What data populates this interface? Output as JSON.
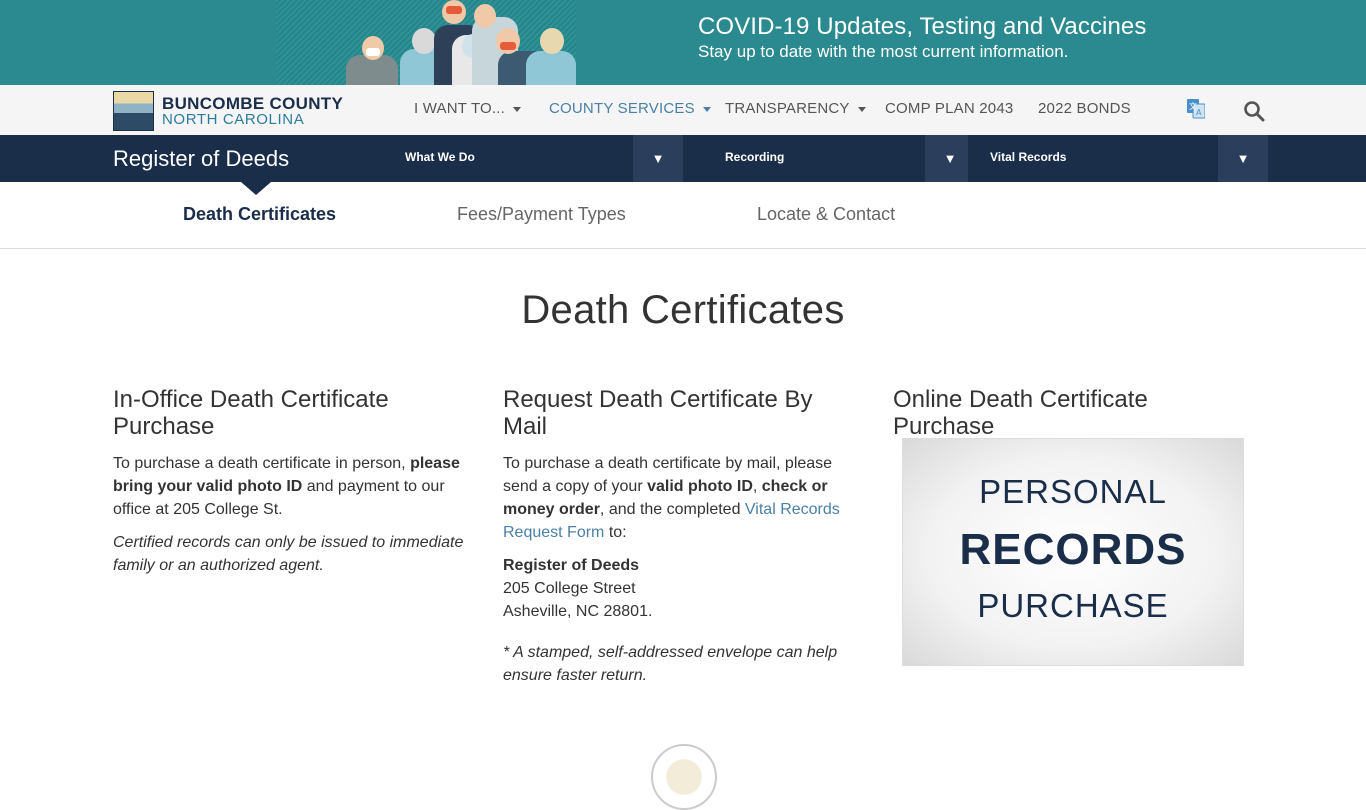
{
  "banner": {
    "title": "COVID-19 Updates, Testing and Vaccines",
    "subtitle": "Stay up to date with the most current information.",
    "bg_color": "#2a8a8f"
  },
  "logo": {
    "line1": "BUNCOMBE COUNTY",
    "line2": "NORTH CAROLINA"
  },
  "nav": {
    "items": [
      {
        "label": "I WANT TO...",
        "dropdown": true
      },
      {
        "label": "COUNTY SERVICES",
        "dropdown": true,
        "active": true
      },
      {
        "label": "TRANSPARENCY",
        "dropdown": true
      },
      {
        "label": "COMP PLAN 2043"
      },
      {
        "label": "2022 BONDS"
      }
    ],
    "icons": [
      "translate-icon",
      "search-icon"
    ]
  },
  "dept": {
    "title": "Register of Deeds",
    "dropdowns": [
      "What We Do",
      "Recording",
      "Vital Records"
    ],
    "toggle_glyph": "▼",
    "bar_color": "#1a2e4a"
  },
  "subnav": {
    "items": [
      "Death Certificates",
      "Fees/Payment Types",
      "Locate & Contact"
    ],
    "active": "Death Certificates"
  },
  "page": {
    "title": "Death Certificates",
    "col1": {
      "heading": "In-Office Death Certificate Purchase",
      "p1_a": "To purchase a death certificate in person, ",
      "p1_b": "please bring your valid photo ID",
      "p1_c": " and payment to our office at 205 College St.",
      "note": "Certified records can only be issued to immediate family or an authorized agent."
    },
    "col2": {
      "heading": "Request Death Certificate By Mail",
      "p1_a": "To purchase a death certificate by mail, please send a copy of your ",
      "p1_b": "valid photo ID",
      "p1_c": ", ",
      "p1_d": "check or money order",
      "p1_e": ", and the completed ",
      "p1_link": "Vital Records Request Form",
      "p1_f": " to:",
      "addr_name": "Register of Deeds",
      "addr_line1": "205 College Street",
      "addr_line2": "Asheville, NC 28801.",
      "note": "* A stamped, self-addressed envelope can help ensure faster return."
    },
    "col3": {
      "heading": "Online Death Certificate Purchase",
      "promo_l1": "PERSONAL",
      "promo_l2": "RECORDS",
      "promo_l3": "PURCHASE"
    }
  },
  "colors": {
    "accent": "#4a7fa6",
    "navy": "#1a2e4a"
  }
}
